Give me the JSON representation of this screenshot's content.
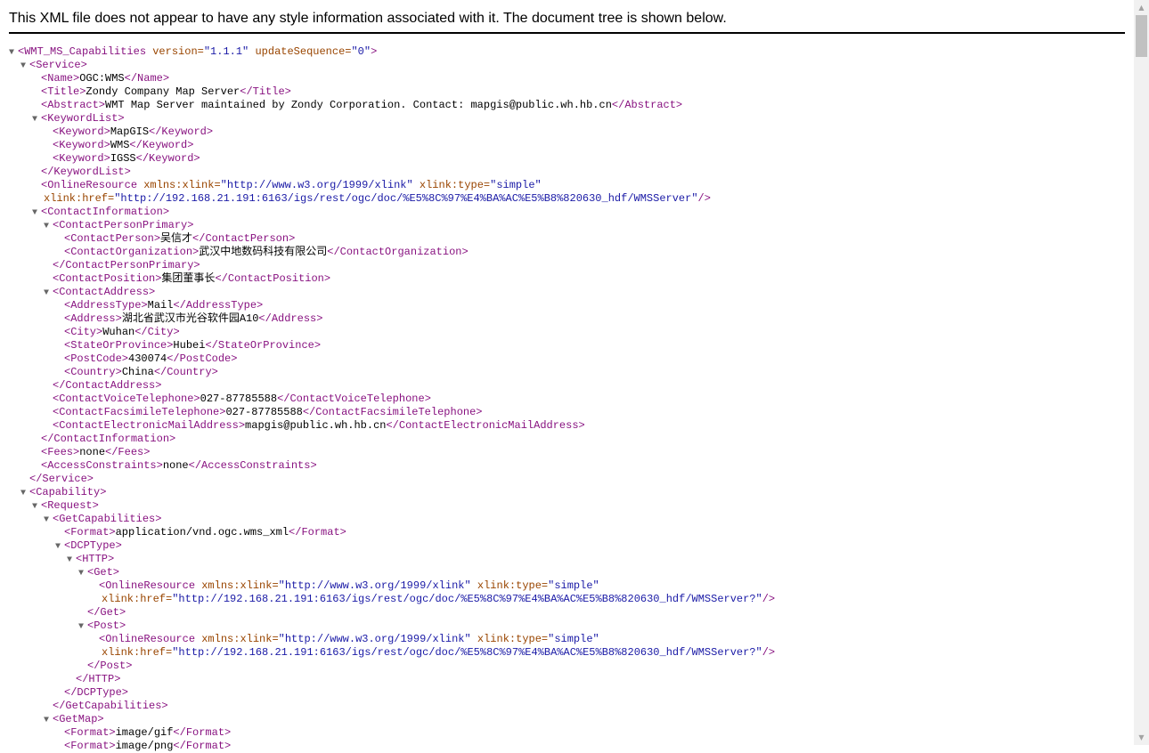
{
  "header": {
    "message": "This XML file does not appear to have any style information associated with it. The document tree is shown below."
  },
  "lines": [
    {
      "d": 0,
      "g": "open",
      "p": [
        [
          "t",
          "<WMT_MS_Capabilities"
        ],
        [
          "a",
          " version="
        ],
        [
          "v",
          "\"1.1.1\""
        ],
        [
          "a",
          " updateSequence="
        ],
        [
          "v",
          "\"0\""
        ],
        [
          "t",
          ">"
        ]
      ]
    },
    {
      "d": 1,
      "g": "open",
      "p": [
        [
          "t",
          "<Service>"
        ]
      ]
    },
    {
      "d": 2,
      "g": "none",
      "p": [
        [
          "t",
          "<Name>"
        ],
        [
          "x",
          "OGC:WMS"
        ],
        [
          "t",
          "</Name>"
        ]
      ]
    },
    {
      "d": 2,
      "g": "none",
      "p": [
        [
          "t",
          "<Title>"
        ],
        [
          "x",
          "Zondy Company Map Server"
        ],
        [
          "t",
          "</Title>"
        ]
      ]
    },
    {
      "d": 2,
      "g": "none",
      "p": [
        [
          "t",
          "<Abstract>"
        ],
        [
          "x",
          "WMT Map Server maintained by Zondy Corporation. Contact: mapgis@public.wh.hb.cn"
        ],
        [
          "t",
          "</Abstract>"
        ]
      ]
    },
    {
      "d": 2,
      "g": "open",
      "p": [
        [
          "t",
          "<KeywordList>"
        ]
      ]
    },
    {
      "d": 3,
      "g": "none",
      "p": [
        [
          "t",
          "<Keyword>"
        ],
        [
          "x",
          "MapGIS"
        ],
        [
          "t",
          "</Keyword>"
        ]
      ]
    },
    {
      "d": 3,
      "g": "none",
      "p": [
        [
          "t",
          "<Keyword>"
        ],
        [
          "x",
          "WMS"
        ],
        [
          "t",
          "</Keyword>"
        ]
      ]
    },
    {
      "d": 3,
      "g": "none",
      "p": [
        [
          "t",
          "<Keyword>"
        ],
        [
          "x",
          "IGSS"
        ],
        [
          "t",
          "</Keyword>"
        ]
      ]
    },
    {
      "d": 2,
      "g": "none",
      "p": [
        [
          "t",
          "</KeywordList>"
        ]
      ]
    },
    {
      "d": 2,
      "g": "none",
      "p": [
        [
          "t",
          "<OnlineResource"
        ],
        [
          "a",
          " xmlns:xlink="
        ],
        [
          "v",
          "\"http://www.w3.org/1999/xlink\""
        ],
        [
          "a",
          " xlink:type="
        ],
        [
          "v",
          "\"simple\""
        ]
      ]
    },
    {
      "d": 2,
      "g": "cont",
      "p": [
        [
          "a",
          "xlink:href="
        ],
        [
          "v",
          "\"http://192.168.21.191:6163/igs/rest/ogc/doc/%E5%8C%97%E4%BA%AC%E5%B8%820630_hdf/WMSServer\""
        ],
        [
          "t",
          "/>"
        ]
      ]
    },
    {
      "d": 2,
      "g": "open",
      "p": [
        [
          "t",
          "<ContactInformation>"
        ]
      ]
    },
    {
      "d": 3,
      "g": "open",
      "p": [
        [
          "t",
          "<ContactPersonPrimary>"
        ]
      ]
    },
    {
      "d": 4,
      "g": "none",
      "p": [
        [
          "t",
          "<ContactPerson>"
        ],
        [
          "x",
          "吴信才"
        ],
        [
          "t",
          "</ContactPerson>"
        ]
      ]
    },
    {
      "d": 4,
      "g": "none",
      "p": [
        [
          "t",
          "<ContactOrganization>"
        ],
        [
          "x",
          "武汉中地数码科技有限公司"
        ],
        [
          "t",
          "</ContactOrganization>"
        ]
      ]
    },
    {
      "d": 3,
      "g": "none",
      "p": [
        [
          "t",
          "</ContactPersonPrimary>"
        ]
      ]
    },
    {
      "d": 3,
      "g": "none",
      "p": [
        [
          "t",
          "<ContactPosition>"
        ],
        [
          "x",
          "集团董事长"
        ],
        [
          "t",
          "</ContactPosition>"
        ]
      ]
    },
    {
      "d": 3,
      "g": "open",
      "p": [
        [
          "t",
          "<ContactAddress>"
        ]
      ]
    },
    {
      "d": 4,
      "g": "none",
      "p": [
        [
          "t",
          "<AddressType>"
        ],
        [
          "x",
          "Mail"
        ],
        [
          "t",
          "</AddressType>"
        ]
      ]
    },
    {
      "d": 4,
      "g": "none",
      "p": [
        [
          "t",
          "<Address>"
        ],
        [
          "x",
          "湖北省武汉市光谷软件园A10"
        ],
        [
          "t",
          "</Address>"
        ]
      ]
    },
    {
      "d": 4,
      "g": "none",
      "p": [
        [
          "t",
          "<City>"
        ],
        [
          "x",
          "Wuhan"
        ],
        [
          "t",
          "</City>"
        ]
      ]
    },
    {
      "d": 4,
      "g": "none",
      "p": [
        [
          "t",
          "<StateOrProvince>"
        ],
        [
          "x",
          "Hubei"
        ],
        [
          "t",
          "</StateOrProvince>"
        ]
      ]
    },
    {
      "d": 4,
      "g": "none",
      "p": [
        [
          "t",
          "<PostCode>"
        ],
        [
          "x",
          "430074"
        ],
        [
          "t",
          "</PostCode>"
        ]
      ]
    },
    {
      "d": 4,
      "g": "none",
      "p": [
        [
          "t",
          "<Country>"
        ],
        [
          "x",
          "China"
        ],
        [
          "t",
          "</Country>"
        ]
      ]
    },
    {
      "d": 3,
      "g": "none",
      "p": [
        [
          "t",
          "</ContactAddress>"
        ]
      ]
    },
    {
      "d": 3,
      "g": "none",
      "p": [
        [
          "t",
          "<ContactVoiceTelephone>"
        ],
        [
          "x",
          "027-87785588"
        ],
        [
          "t",
          "</ContactVoiceTelephone>"
        ]
      ]
    },
    {
      "d": 3,
      "g": "none",
      "p": [
        [
          "t",
          "<ContactFacsimileTelephone>"
        ],
        [
          "x",
          "027-87785588"
        ],
        [
          "t",
          "</ContactFacsimileTelephone>"
        ]
      ]
    },
    {
      "d": 3,
      "g": "none",
      "p": [
        [
          "t",
          "<ContactElectronicMailAddress>"
        ],
        [
          "x",
          "mapgis@public.wh.hb.cn"
        ],
        [
          "t",
          "</ContactElectronicMailAddress>"
        ]
      ]
    },
    {
      "d": 2,
      "g": "none",
      "p": [
        [
          "t",
          "</ContactInformation>"
        ]
      ]
    },
    {
      "d": 2,
      "g": "none",
      "p": [
        [
          "t",
          "<Fees>"
        ],
        [
          "x",
          "none"
        ],
        [
          "t",
          "</Fees>"
        ]
      ]
    },
    {
      "d": 2,
      "g": "none",
      "p": [
        [
          "t",
          "<AccessConstraints>"
        ],
        [
          "x",
          "none"
        ],
        [
          "t",
          "</AccessConstraints>"
        ]
      ]
    },
    {
      "d": 1,
      "g": "none",
      "p": [
        [
          "t",
          "</Service>"
        ]
      ]
    },
    {
      "d": 1,
      "g": "open",
      "p": [
        [
          "t",
          "<Capability>"
        ]
      ]
    },
    {
      "d": 2,
      "g": "open",
      "p": [
        [
          "t",
          "<Request>"
        ]
      ]
    },
    {
      "d": 3,
      "g": "open",
      "p": [
        [
          "t",
          "<GetCapabilities>"
        ]
      ]
    },
    {
      "d": 4,
      "g": "none",
      "p": [
        [
          "t",
          "<Format>"
        ],
        [
          "x",
          "application/vnd.ogc.wms_xml"
        ],
        [
          "t",
          "</Format>"
        ]
      ]
    },
    {
      "d": 4,
      "g": "open",
      "p": [
        [
          "t",
          "<DCPType>"
        ]
      ]
    },
    {
      "d": 5,
      "g": "open",
      "p": [
        [
          "t",
          "<HTTP>"
        ]
      ]
    },
    {
      "d": 6,
      "g": "open",
      "p": [
        [
          "t",
          "<Get>"
        ]
      ]
    },
    {
      "d": 7,
      "g": "none",
      "p": [
        [
          "t",
          "<OnlineResource"
        ],
        [
          "a",
          " xmlns:xlink="
        ],
        [
          "v",
          "\"http://www.w3.org/1999/xlink\""
        ],
        [
          "a",
          " xlink:type="
        ],
        [
          "v",
          "\"simple\""
        ]
      ]
    },
    {
      "d": 7,
      "g": "cont",
      "p": [
        [
          "a",
          "xlink:href="
        ],
        [
          "v",
          "\"http://192.168.21.191:6163/igs/rest/ogc/doc/%E5%8C%97%E4%BA%AC%E5%B8%820630_hdf/WMSServer?\""
        ],
        [
          "t",
          "/>"
        ]
      ]
    },
    {
      "d": 6,
      "g": "none",
      "p": [
        [
          "t",
          "</Get>"
        ]
      ]
    },
    {
      "d": 6,
      "g": "open",
      "p": [
        [
          "t",
          "<Post>"
        ]
      ]
    },
    {
      "d": 7,
      "g": "none",
      "p": [
        [
          "t",
          "<OnlineResource"
        ],
        [
          "a",
          " xmlns:xlink="
        ],
        [
          "v",
          "\"http://www.w3.org/1999/xlink\""
        ],
        [
          "a",
          " xlink:type="
        ],
        [
          "v",
          "\"simple\""
        ]
      ]
    },
    {
      "d": 7,
      "g": "cont",
      "p": [
        [
          "a",
          "xlink:href="
        ],
        [
          "v",
          "\"http://192.168.21.191:6163/igs/rest/ogc/doc/%E5%8C%97%E4%BA%AC%E5%B8%820630_hdf/WMSServer?\""
        ],
        [
          "t",
          "/>"
        ]
      ]
    },
    {
      "d": 6,
      "g": "none",
      "p": [
        [
          "t",
          "</Post>"
        ]
      ]
    },
    {
      "d": 5,
      "g": "none",
      "p": [
        [
          "t",
          "</HTTP>"
        ]
      ]
    },
    {
      "d": 4,
      "g": "none",
      "p": [
        [
          "t",
          "</DCPType>"
        ]
      ]
    },
    {
      "d": 3,
      "g": "none",
      "p": [
        [
          "t",
          "</GetCapabilities>"
        ]
      ]
    },
    {
      "d": 3,
      "g": "open",
      "p": [
        [
          "t",
          "<GetMap>"
        ]
      ]
    },
    {
      "d": 4,
      "g": "none",
      "p": [
        [
          "t",
          "<Format>"
        ],
        [
          "x",
          "image/gif"
        ],
        [
          "t",
          "</Format>"
        ]
      ]
    },
    {
      "d": 4,
      "g": "none",
      "p": [
        [
          "t",
          "<Format>"
        ],
        [
          "x",
          "image/png"
        ],
        [
          "t",
          "</Format>"
        ]
      ]
    }
  ],
  "scrollbar": {
    "up_icon": "▲",
    "down_icon": "▼"
  }
}
